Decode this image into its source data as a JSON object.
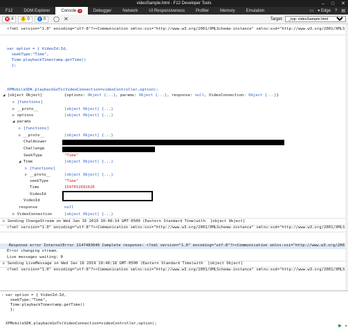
{
  "window": {
    "title": "videoSample.html - F12 Developer Tools"
  },
  "tabs": {
    "f12": "F12",
    "dom_explorer": "DOM Explorer",
    "console": "Console",
    "console_badge": "4",
    "debugger": "Debugger",
    "network": "Network",
    "ui_responsiveness": "UI Responsiveness",
    "profiler": "Profiler",
    "memory": "Memory",
    "emulation": "Emulation",
    "browser": "Edge"
  },
  "toolbar": {
    "errors": "4",
    "warnings": "0",
    "messages": "0",
    "target_label": "Target:",
    "target_value": "_top: videoSample.html"
  },
  "console": {
    "l1": "<?xml version=\"1.0\" encoding=\"utf-8\"?><Communication xmlns:xsi=\"http://www.w3.org/2001/XMLSchema-instance\" xmlns:xsd=\"http://www.w3.org/2001/XMLSc",
    "c1": "var option = { VideoId:Id,",
    "c2": "  seekType:\"Time\",",
    "c3": "  Time:playbackTimestamp.getTime()",
    "c4": "  };",
    "call": "XPMobileSDK.playbackGoTo(VideoConnection=videoController,option);",
    "obj_root": "◢ [object Object]",
    "obj_root_summary_a": "{options: ",
    "obj_root_summary_b": "Object {...}",
    "obj_root_summary_c": ", params: ",
    "obj_root_summary_d": "Object {...}",
    "obj_root_summary_e": ", response: ",
    "obj_root_summary_f": "null",
    "obj_root_summary_g": ", VideoConnection: ",
    "obj_root_summary_h": "Object {...}",
    "obj_root_summary_i": "}",
    "functions1": "▷ [functions]",
    "proto1": "▷ __proto__",
    "proto1_val": "[object Object] {...}",
    "options": "▷ options",
    "options_val": "[object Object] {...}",
    "params": "◢ params",
    "functions2": "▷ [functions]",
    "proto2": "▷ __proto__",
    "proto2_val": "[object Object] {...}",
    "chal_answer": "ChalAnswer",
    "challenge": "Challenge",
    "seektype_key": "SeekType",
    "seektype_val": "\"Time\"",
    "time_key": "◢ Time",
    "time_val": "[object Object] {...}",
    "functions3": "▷ [functions]",
    "proto3": "▷ __proto__",
    "proto3_val": "[object Object] {...}",
    "seektype2_key": "seekType",
    "seektype2_val": "\"Time\"",
    "time2_key": "Time",
    "time2_val": "1547652692620",
    "videoid_key": "VideoId",
    "videoid2_key": "VideoId",
    "response_key": "response",
    "response_val": "null",
    "vc_key": "▷ VideoConnection",
    "vc_val": "[object Object] {...}",
    "sending1": "▷ Sending ChangeStream on Wed Jan 16 2019 10:48:14 GMT-0500 (Eastern Standard Time)with  [object Object]",
    "xml2": "<?xml version=\"1.0\" encoding=\"utf-8\"?><Communication xmlns:xsi=\"http://www.w3.org/2001/XMLSchema-instance\" xmlns:xsd=\"http://www.w3.org/2001/XMLSc",
    "error_line": "  Response error InternalError 2147483646 Complete response: <?xml version=\"1.0\" encoding=\"utf-8\"?><Communication xmlns:xsi=\"http://www.w3.org/2001",
    "err_change": "Error changing stream.",
    "live_msgs": "Live messages waiting: 0",
    "sending2": "▷ Sending LiveMessage on Wed Jan 16 2019 10:48:18 GMT-0500 (Eastern Standard Time)with  [object Object]",
    "xml3": "<?xml version=\"1.0\" encoding=\"utf-8\"?><Communication xmlns:xsi=\"http://www.w3.org/2001/XMLSchema-instance\" xmlns:xsd=\"http://www.w3.org/2001/XMLSc"
  },
  "input": {
    "i1": "var option = { VideoId:Id,",
    "i2": "  seekType:\"Time\",",
    "i3": "  Time:playbackTimestamp.getTime()",
    "i4": "  };",
    "i5": "XPMobileSDK.playbackGoTo(VideoConnection=videoController,option);"
  }
}
